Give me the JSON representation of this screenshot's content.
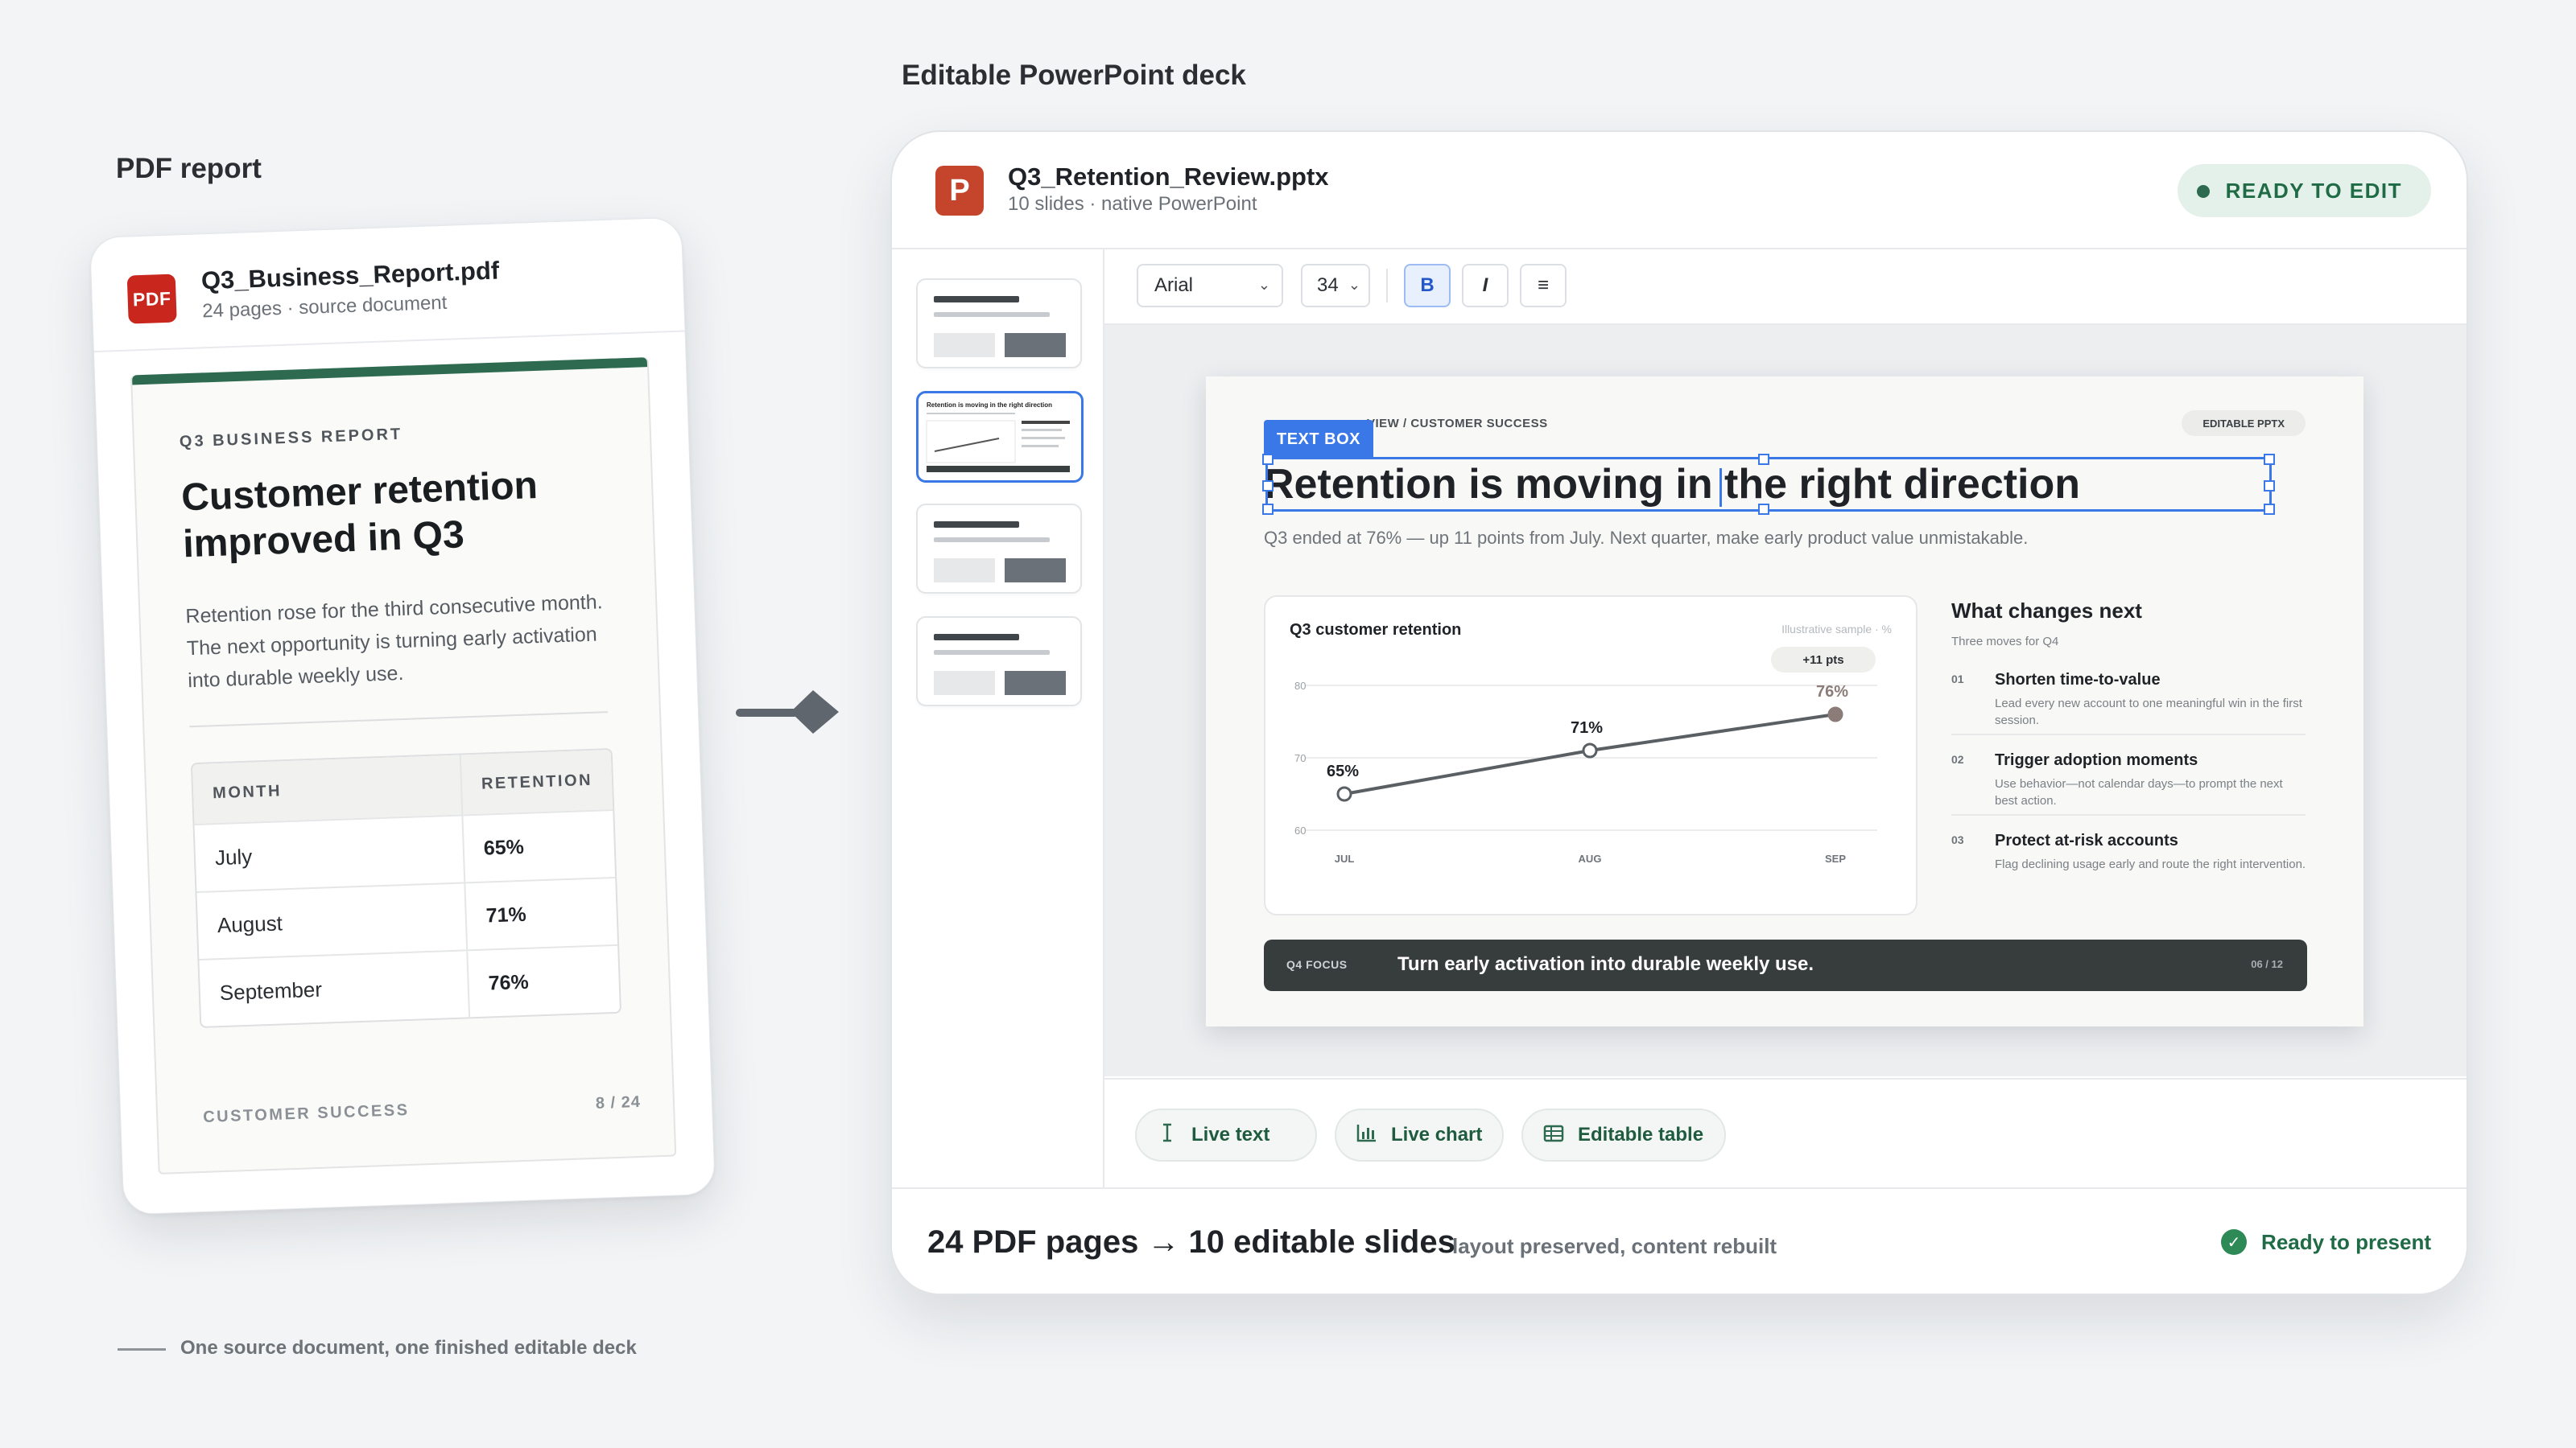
{
  "left": {
    "section_label": "PDF report",
    "file": {
      "name": "Q3_Business_Report.pdf",
      "meta": "24 pages · source document",
      "icon_label": "PDF",
      "icon": "pdf-file-icon"
    },
    "page": {
      "eyebrow": "Q3 BUSINESS REPORT",
      "title": "Customer retention improved in Q3",
      "body": "Retention rose for the third consecutive month. The next opportunity is turning early activation into durable weekly use.",
      "table": {
        "headers": [
          "MONTH",
          "RETENTION"
        ],
        "rows": [
          {
            "month": "July",
            "retention": "65%"
          },
          {
            "month": "August",
            "retention": "71%"
          },
          {
            "month": "September",
            "retention": "76%"
          }
        ]
      },
      "footer_left": "CUSTOMER SUCCESS",
      "footer_right": "8 / 24"
    },
    "caption": "One source document, one finished editable deck"
  },
  "right": {
    "section_label": "Editable PowerPoint deck",
    "file": {
      "name": "Q3_Retention_Review.pptx",
      "meta": "10 slides · native PowerPoint",
      "icon_label": "P",
      "icon": "powerpoint-icon"
    },
    "status": "READY TO EDIT",
    "thumbnails": {
      "count": 4,
      "active_index": 1,
      "active_mini_title": "Retention is moving in the right direction"
    },
    "toolbar": {
      "font": "Arial",
      "size": "34",
      "bold": "B",
      "italic": "I",
      "list_icon": "≡"
    },
    "slide": {
      "breadcrumb": "VIEW / CUSTOMER SUCCESS",
      "badge": "EDITABLE PPTX",
      "textbox_tag": "TEXT BOX",
      "title": "Retention is moving in the right direction",
      "subtitle": "Q3 ended at 76% — up 11 points from July. Next quarter, make early product value unmistakable.",
      "chart_title": "Q3 customer retention",
      "chart_note": "Illustrative sample · %",
      "chart_delta": "+11 pts",
      "next": {
        "title": "What changes next",
        "subtitle": "Three moves for Q4",
        "items": [
          {
            "num": "01",
            "heading": "Shorten time-to-value",
            "body": "Lead every new account to one meaningful win in the first session."
          },
          {
            "num": "02",
            "heading": "Trigger adoption moments",
            "body": "Use behavior—not calendar days—to prompt the next best action."
          },
          {
            "num": "03",
            "heading": "Protect at-risk accounts",
            "body": "Flag declining usage early and route the right intervention."
          }
        ]
      },
      "focus": {
        "tag": "Q4 FOCUS",
        "text": "Turn early activation into durable weekly use.",
        "page": "06 / 12"
      }
    },
    "chips": [
      {
        "label": "Live text",
        "icon": "text-cursor-icon"
      },
      {
        "label": "Live chart",
        "icon": "bar-chart-icon"
      },
      {
        "label": "Editable table",
        "icon": "table-icon"
      }
    ],
    "footer": {
      "main": "24 PDF pages → 10 editable slides",
      "sub": "layout preserved, content rebuilt",
      "status": "Ready to present"
    }
  },
  "chart_data": {
    "type": "line",
    "title": "Q3 customer retention",
    "categories": [
      "JUL",
      "AUG",
      "SEP"
    ],
    "values": [
      65,
      71,
      76
    ],
    "data_labels": [
      "65%",
      "71%",
      "76%"
    ],
    "yticks": [
      60,
      70,
      80
    ],
    "ylim": [
      60,
      80
    ],
    "grid": true,
    "colors": {
      "line": "#5a5f63",
      "last_point": "#8b7c78"
    }
  },
  "colors": {
    "accent_green": "#2d6a4f",
    "selection_blue": "#3b78e7",
    "pdf_red": "#c9271e",
    "ppt_orange": "#c4452c"
  }
}
